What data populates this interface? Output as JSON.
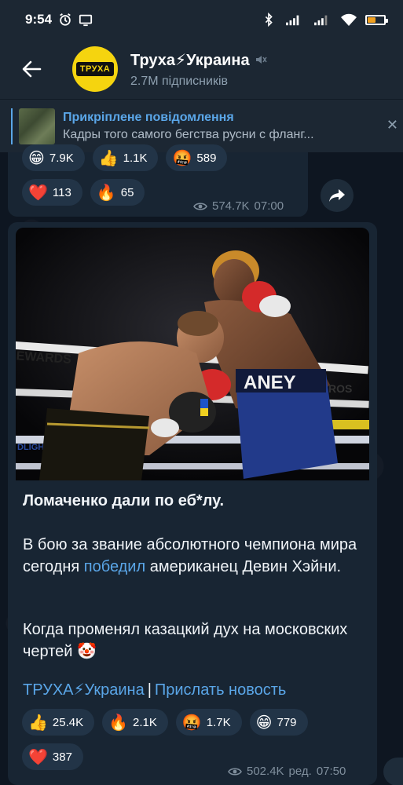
{
  "status_bar": {
    "time": "9:54"
  },
  "header": {
    "title": "Труха⚡Украина",
    "subscribers": "2.7M підписників",
    "avatar_text": "ТРУХА"
  },
  "pinned": {
    "title": "Прикріплене повідомлення",
    "preview": "Кадры того самого бегства русни с фланг..."
  },
  "message1": {
    "reactions": [
      {
        "emoji": "😁",
        "count": "7.9K"
      },
      {
        "emoji": "👍",
        "count": "1.1K"
      },
      {
        "emoji": "🤬",
        "count": "589"
      },
      {
        "emoji": "❤️",
        "count": "113"
      },
      {
        "emoji": "🔥",
        "count": "65"
      }
    ],
    "views": "574.7K",
    "time": "07:00"
  },
  "message2": {
    "photo_text": {
      "banner_left": "EWARDS",
      "trunks": "ANEY",
      "ropes_right": "ROS",
      "rope_mid": "DLIGHT"
    },
    "title": "Ломаченко дали по еб*лу.",
    "p1_before": "В бою за звание абсолютного чемпиона мира сегодня ",
    "p1_link": "победил",
    "p1_after": " американец Девин Хэйни.",
    "p2": "Когда променял казацкий дух на московских чертей 🤡",
    "signature_channel": "ТРУХА⚡Украина",
    "signature_sep": "|",
    "signature_link": "Прислать новость",
    "reactions": [
      {
        "emoji": "👍",
        "count": "25.4K"
      },
      {
        "emoji": "🔥",
        "count": "2.1K"
      },
      {
        "emoji": "🤬",
        "count": "1.7K"
      },
      {
        "emoji": "😁",
        "count": "779"
      },
      {
        "emoji": "❤️",
        "count": "387"
      }
    ],
    "views": "502.4K",
    "edited": "ред.",
    "time": "07:50"
  },
  "colors": {
    "accent": "#5aa6e8",
    "header_bg": "#1c2733",
    "bubble_bg": "#182533"
  }
}
